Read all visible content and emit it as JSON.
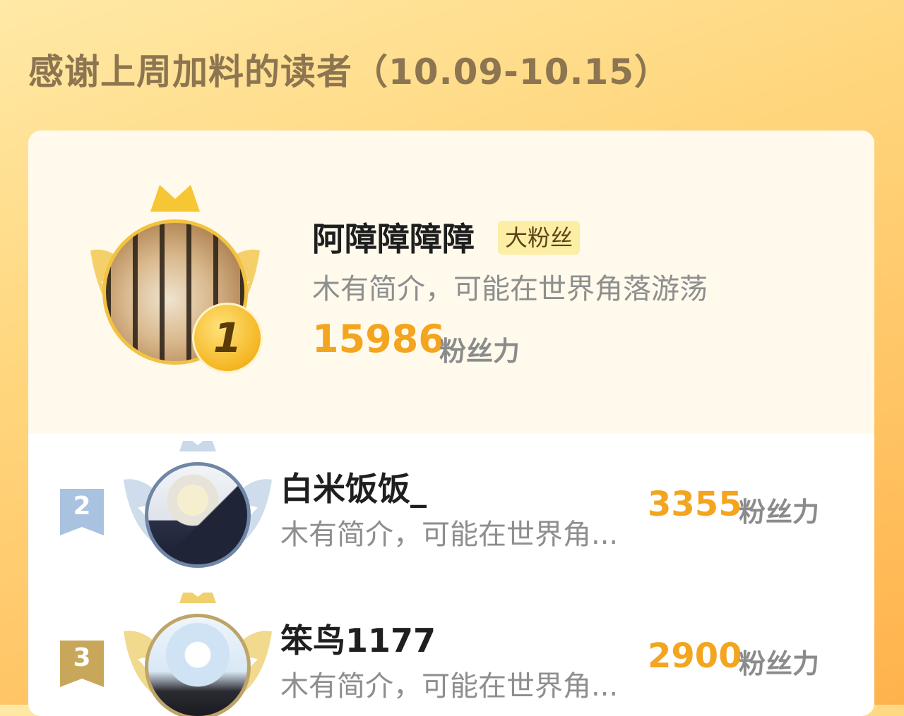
{
  "header": {
    "title": "感谢上周加料的读者（10.09-10.15）"
  },
  "top_reader": {
    "rank": "1",
    "name": "阿障障障障",
    "badge": "大粉丝",
    "bio": "木有简介，可能在世界角落游荡",
    "score": "15986",
    "unit": "粉丝力",
    "icons": [
      "gold-crown-icon",
      "gold-wings-icon",
      "rank-1-medal-icon"
    ]
  },
  "readers": [
    {
      "rank": "2",
      "name": "白米饭饭_",
      "bio": "木有简介，可能在世界角...",
      "score": "3355",
      "unit": "粉丝力",
      "color": "#a9c2df"
    },
    {
      "rank": "3",
      "name": "笨鸟1177",
      "bio": "木有简介，可能在世界角...",
      "score": "2900",
      "unit": "粉丝力",
      "color": "#c9a75a"
    }
  ],
  "colors": {
    "accent": "#f3a51f",
    "gold": "#f2c241",
    "silver": "#a9c2df",
    "bronze": "#c9a75a"
  }
}
